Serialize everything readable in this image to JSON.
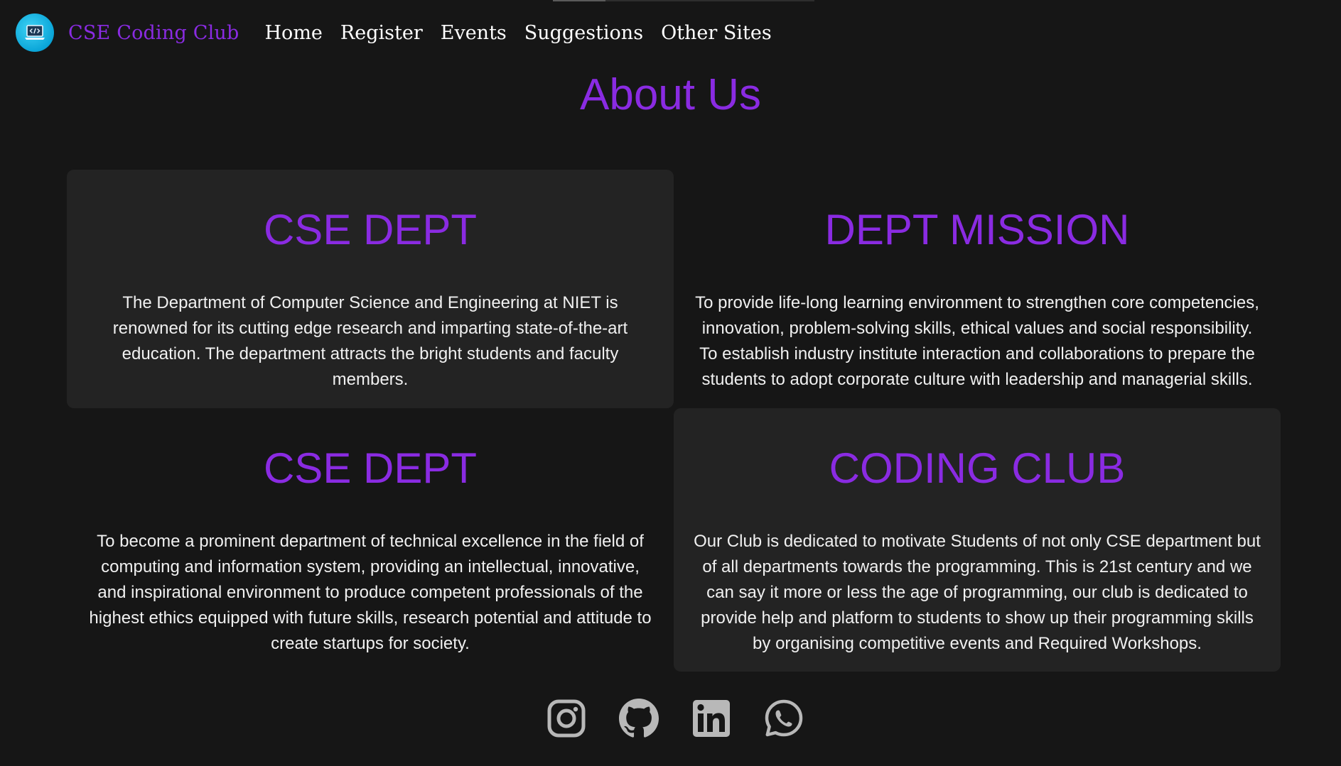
{
  "nav": {
    "brand": "CSE Coding Club",
    "links": [
      "Home",
      "Register",
      "Events",
      "Suggestions",
      "Other Sites"
    ]
  },
  "page": {
    "title": "About Us"
  },
  "cards": [
    {
      "title": "CSE DEPT",
      "text": "The Department of Computer Science and Engineering at NIET is renowned for its cutting edge research and imparting state-of-the-art education. The department attracts the bright students and faculty members."
    },
    {
      "title": "DEPT MISSION",
      "text": "To provide life-long learning environment to strengthen core competencies, innovation, problem-solving skills, ethical values and social responsibility. To establish industry institute interaction and collaborations to prepare the students to adopt corporate culture with leadership and managerial skills."
    },
    {
      "title": "CSE DEPT",
      "text": "To become a prominent department of technical excellence in the field of computing and information system, providing an intellectual, innovative, and inspirational environment to produce competent professionals of the highest ethics equipped with future skills, research potential and attitude to create startups for society."
    },
    {
      "title": "CODING CLUB",
      "text": "Our Club is dedicated to motivate Students of not only CSE department but of all departments towards the programming. This is 21st century and we can say it more or less the age of programming, our club is dedicated to provide help and platform to students to show up their programming skills by organising competitive events and Required Workshops."
    }
  ],
  "socials": [
    "instagram-icon",
    "github-icon",
    "linkedin-icon",
    "whatsapp-icon"
  ],
  "colors": {
    "accent": "#8a2be2",
    "background": "#161616",
    "card": "#232323",
    "icon": "#b8b8b8"
  }
}
